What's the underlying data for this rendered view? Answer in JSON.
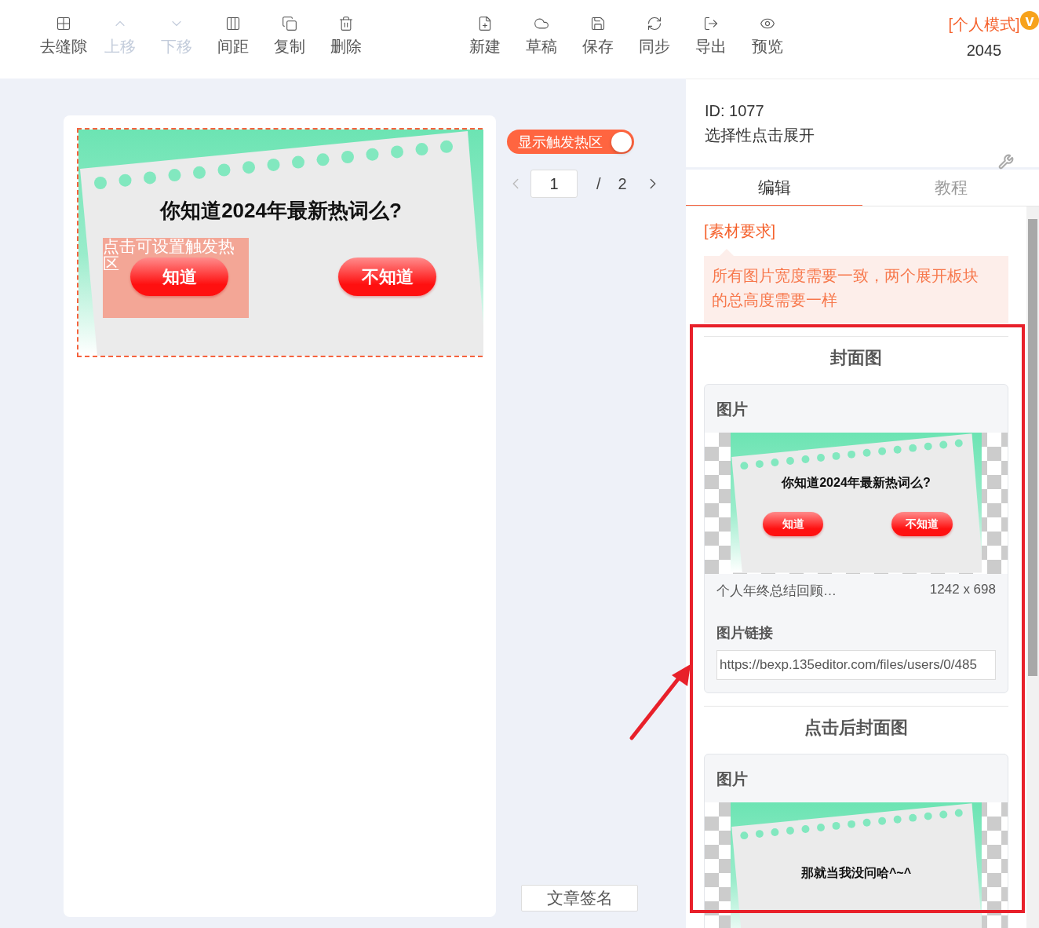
{
  "toolbar": {
    "left": [
      {
        "label": "去缝隙",
        "disabled": false
      },
      {
        "label": "上移",
        "disabled": true
      },
      {
        "label": "下移",
        "disabled": true
      },
      {
        "label": "间距",
        "disabled": false
      },
      {
        "label": "复制",
        "disabled": false
      },
      {
        "label": "删除",
        "disabled": false
      }
    ],
    "center": [
      {
        "label": "新建",
        "disabled": false
      },
      {
        "label": "草稿",
        "disabled": false
      },
      {
        "label": "保存",
        "disabled": false
      },
      {
        "label": "同步",
        "disabled": false
      },
      {
        "label": "导出",
        "disabled": false
      },
      {
        "label": "预览",
        "disabled": false
      }
    ]
  },
  "mode": {
    "label": "[个人模式]",
    "badge": "v",
    "count": "2045"
  },
  "canvas": {
    "banner": {
      "title": "你知道2024年最新热词么?",
      "buttons": [
        "知道",
        "不知道"
      ]
    },
    "hotspot": {
      "label": "点击可设置触发热区"
    }
  },
  "hotspot_toggle": {
    "label": "显示触发热区",
    "on": true
  },
  "pager": {
    "page": "1",
    "separator": "/",
    "total": "2"
  },
  "signature_button": "文章签名",
  "panel": {
    "id": "ID: 1077",
    "name": "选择性点击展开",
    "tabs": [
      {
        "label": "编辑",
        "selected": true
      },
      {
        "label": "教程",
        "selected": false
      }
    ],
    "requirement_title": "[素材要求]",
    "requirement_text": "所有图片宽度需要一致，两个展开板块的总高度需要一样",
    "sections": [
      {
        "title": "封面图",
        "card_title": "图片",
        "image": {
          "title": "你知道2024年最新热词么?",
          "buttons": [
            "知道",
            "不知道"
          ]
        },
        "file_name": "个人年终总结回顾…",
        "size": "1242 x 698",
        "link_label": "图片链接",
        "link": "https://bexp.135editor.com/files/users/0/485"
      },
      {
        "title": "点击后封面图",
        "card_title": "图片",
        "image": {
          "title": "那就当我没问哈^~^"
        }
      }
    ]
  }
}
